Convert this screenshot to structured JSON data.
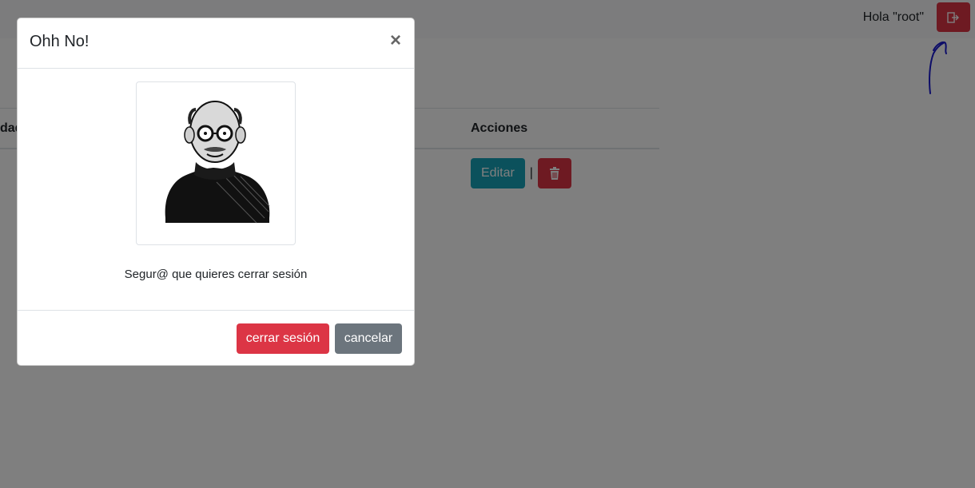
{
  "navbar": {
    "greeting": "Hola \"root\"",
    "logout_icon": "logout-icon"
  },
  "table": {
    "headers": {
      "left_partial": "dad",
      "actions": "Acciones"
    },
    "row": {
      "edit_label": "Editar",
      "separator": "|",
      "delete_icon": "trash-icon"
    }
  },
  "modal": {
    "title": "Ohh No!",
    "close": "×",
    "message": "Segur@ que quieres cerrar sesión",
    "confirm_label": "cerrar sesión",
    "cancel_label": "cancelar"
  },
  "colors": {
    "danger": "#dc3545",
    "info": "#17a2b8",
    "secondary": "#6c757d",
    "annotation": "#1a1ad0"
  }
}
